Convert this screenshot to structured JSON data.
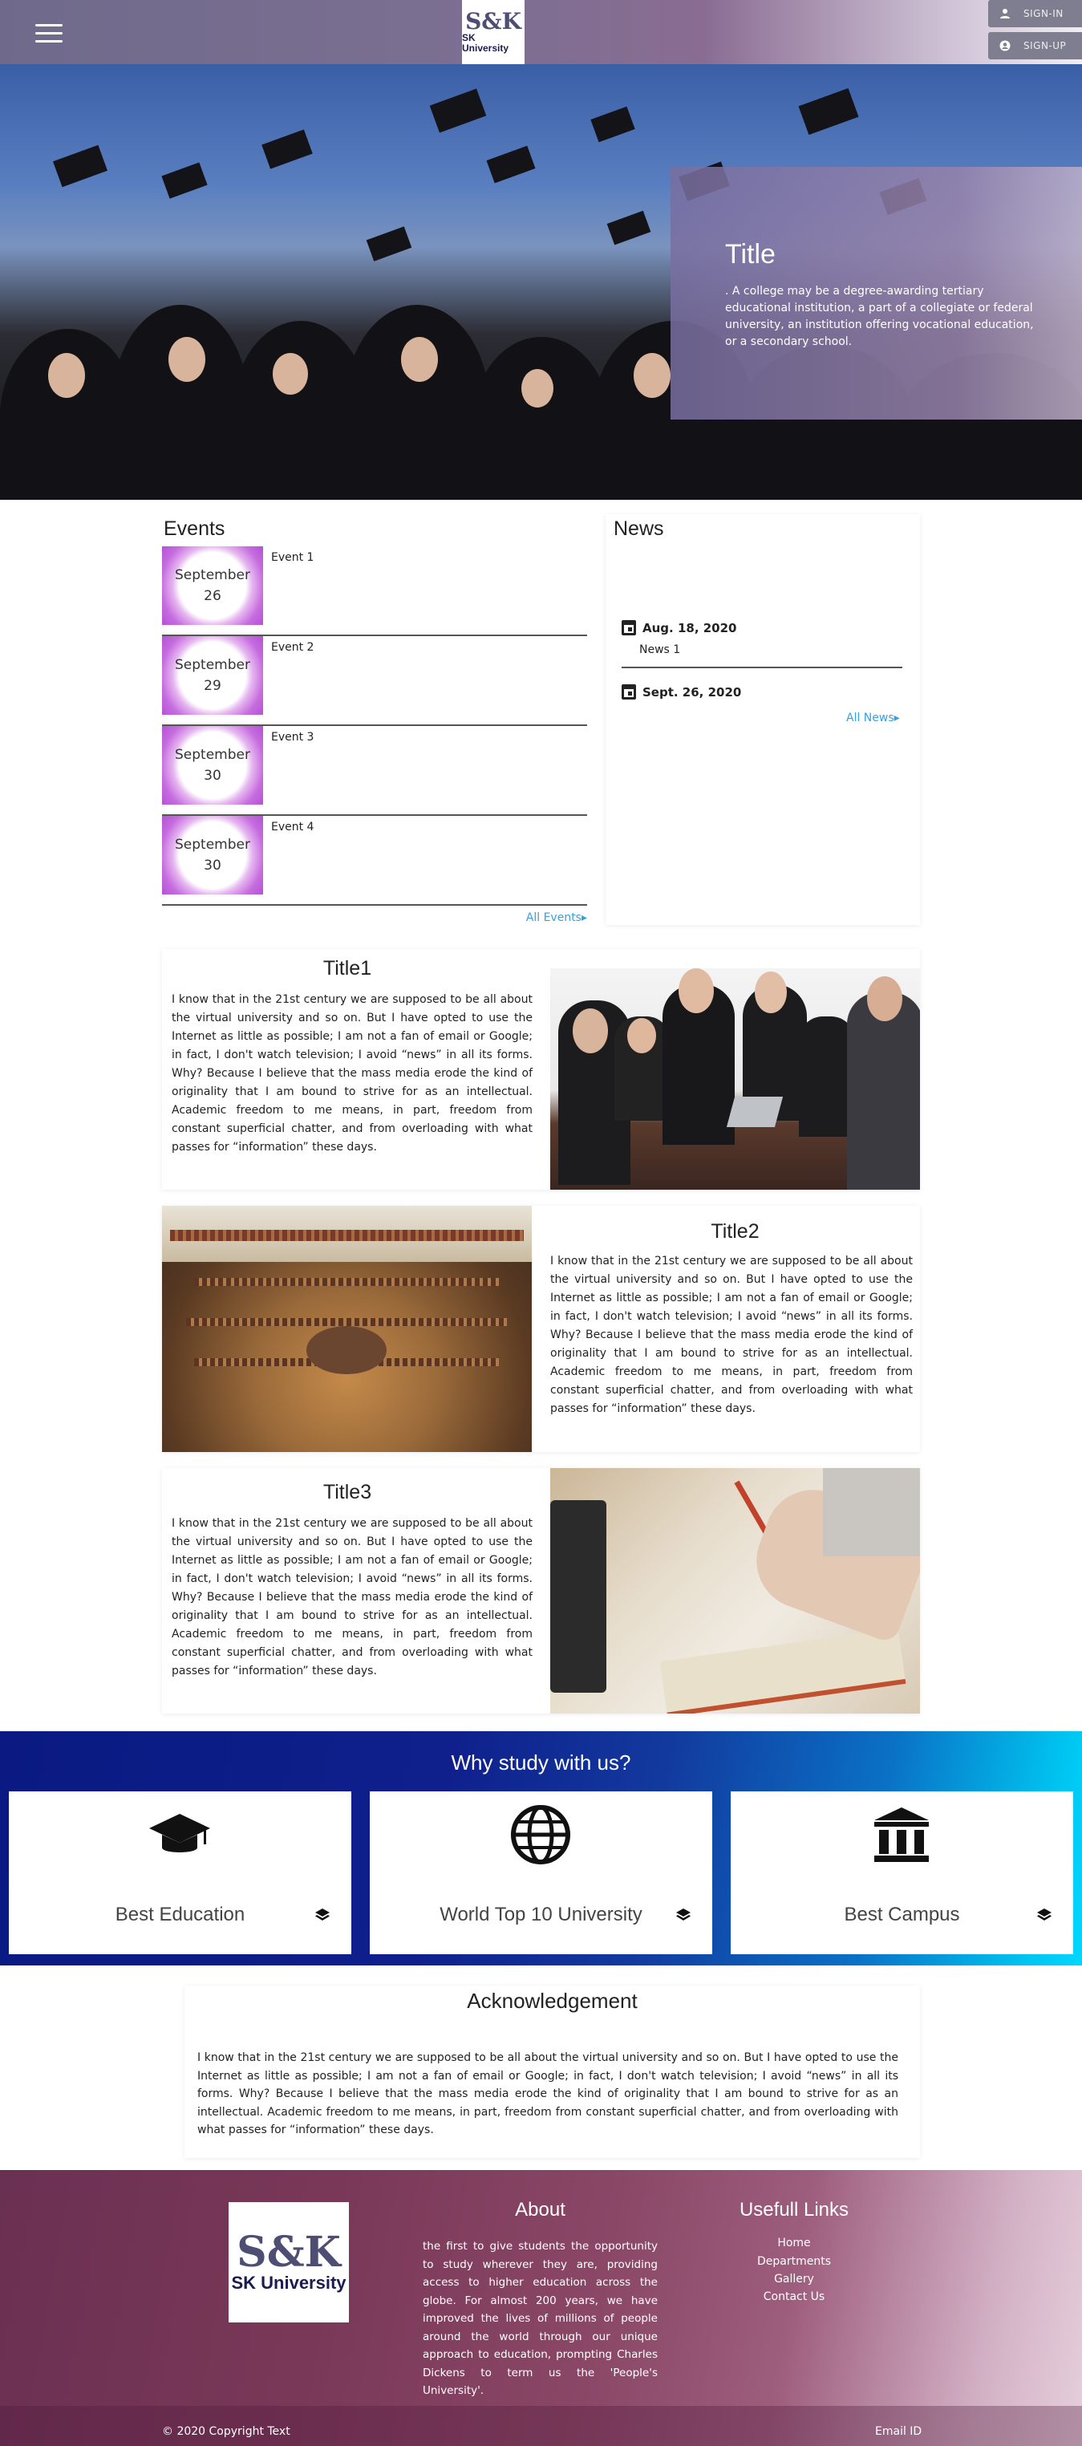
{
  "header": {
    "logo_big": "S&K",
    "logo_small": "SK University",
    "sign_in": "SIGN-IN",
    "sign_up": "SIGN-UP"
  },
  "hero": {
    "title": "Title",
    "text": ". A college may be a degree-awarding tertiary educational institution, a part of a collegiate or federal university, an institution offering vocational education, or a secondary school."
  },
  "events": {
    "heading": "Events",
    "items": [
      {
        "month": "September",
        "day": "26",
        "name": "Event 1"
      },
      {
        "month": "September",
        "day": "29",
        "name": "Event 2"
      },
      {
        "month": "September",
        "day": "30",
        "name": "Event 3"
      },
      {
        "month": "September",
        "day": "30",
        "name": "Event 4"
      }
    ],
    "all_link": "All Events▸"
  },
  "news": {
    "heading": "News",
    "items": [
      {
        "date": "Aug. 18, 2020",
        "title": "News 1"
      },
      {
        "date": "Sept. 26, 2020",
        "title": ""
      }
    ],
    "all_link": "All News▸"
  },
  "features": [
    {
      "title": "Title1",
      "text": "I know that in the 21st century we are supposed to be all about the virtual university and so on. But I have opted to use the Internet as little as possible; I am not a fan of email or Google; in fact, I don't watch television; I avoid “news” in all its forms. Why? Because I believe that the mass media erode the kind of originality that I am bound to strive for as an intellectual. Academic freedom to me means, in part, freedom from constant superficial chatter, and from overloading with what passes for “information” these days."
    },
    {
      "title": "Title2",
      "text": "I know that in the 21st century we are supposed to be all about the virtual university and so on. But I have opted to use the Internet as little as possible; I am not a fan of email or Google; in fact, I don't watch television; I avoid “news” in all its forms. Why? Because I believe that the mass media erode the kind of originality that I am bound to strive for as an intellectual. Academic freedom to me means, in part, freedom from constant superficial chatter, and from overloading with what passes for “information” these days."
    },
    {
      "title": "Title3",
      "text": "I know that in the 21st century we are supposed to be all about the virtual university and so on. But I have opted to use the Internet as little as possible; I am not a fan of email or Google; in fact, I don't watch television; I avoid “news” in all its forms. Why? Because I believe that the mass media erode the kind of originality that I am bound to strive for as an intellectual. Academic freedom to me means, in part, freedom from constant superficial chatter, and from overloading with what passes for “information” these days."
    }
  ],
  "why": {
    "heading": "Why study with us?",
    "cards": [
      {
        "label": "Best Education",
        "icon": "graduation-cap-icon"
      },
      {
        "label": "World Top 10 University",
        "icon": "globe-icon"
      },
      {
        "label": "Best Campus",
        "icon": "institution-icon"
      }
    ]
  },
  "ack": {
    "heading": "Acknowledgement",
    "text": "I know that in the 21st century we are supposed to be all about the virtual university and so on. But I have opted to use the Internet as little as possible; I am not a fan of email or Google; in fact, I don't watch television; I avoid “news” in all its forms. Why? Because I believe that the mass media erode the kind of originality that I am bound to strive for as an intellectual. Academic freedom to me means, in part, freedom from constant superficial chatter, and from overloading with what passes for “information” these days."
  },
  "footer": {
    "logo_big": "S&K",
    "logo_small": "SK University",
    "about_heading": "About",
    "about_text": "the first to give students the opportunity to study wherever they are, providing access to higher education across the globe. For almost 200 years, we have improved the lives of millions of people around the world through our unique approach to education, prompting Charles Dickens to term us the 'People's University'.",
    "links_heading": "Usefull Links",
    "links": [
      "Home",
      "Departments",
      "Gallery",
      "Contact Us"
    ],
    "copyright": "© 2020 Copyright Text",
    "email": "Email ID"
  }
}
